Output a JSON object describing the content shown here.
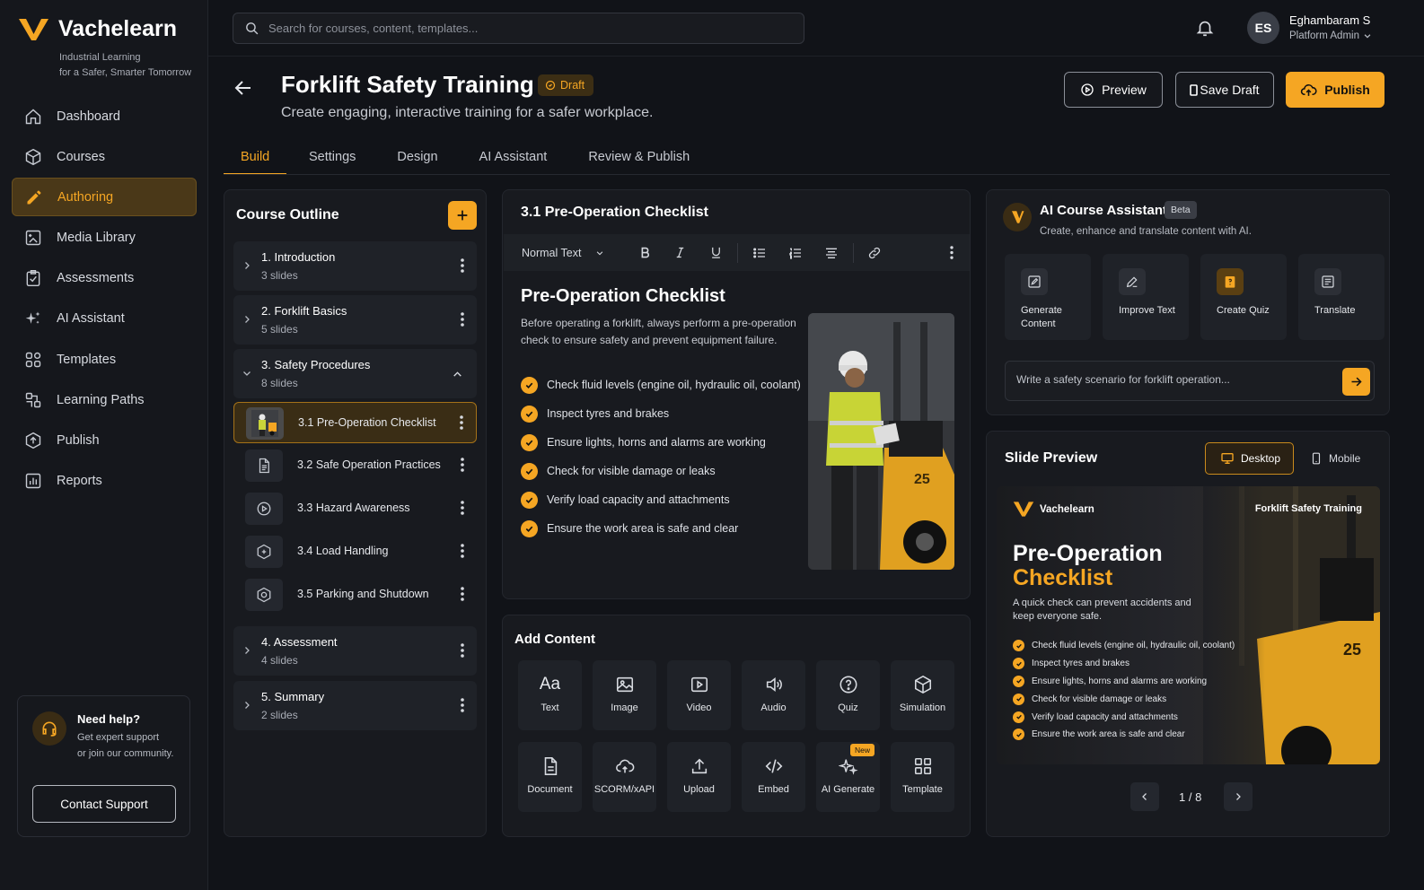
{
  "brand": {
    "name": "Vachelearn",
    "tagline_1": "Industrial Learning",
    "tagline_2": "for a Safer, Smarter Tomorrow"
  },
  "nav": [
    {
      "label": "Dashboard",
      "icon": "home-icon"
    },
    {
      "label": "Courses",
      "icon": "cube-icon"
    },
    {
      "label": "Authoring",
      "icon": "pencil-icon",
      "active": true
    },
    {
      "label": "Media Library",
      "icon": "media-icon"
    },
    {
      "label": "Assessments",
      "icon": "clipboard-check-icon"
    },
    {
      "label": "AI Assistant",
      "icon": "sparkle-icon"
    },
    {
      "label": "Templates",
      "icon": "grid-icon"
    },
    {
      "label": "Learning Paths",
      "icon": "path-icon"
    },
    {
      "label": "Publish",
      "icon": "upload-icon"
    },
    {
      "label": "Reports",
      "icon": "chart-icon"
    }
  ],
  "help": {
    "title": "Need help?",
    "line_1": "Get expert support",
    "line_2": "or join our community.",
    "button": "Contact Support"
  },
  "search": {
    "placeholder": "Search for courses, content, templates..."
  },
  "user": {
    "initials": "ES",
    "name": "Eghambaram S",
    "role": "Platform Admin"
  },
  "header": {
    "title": "Forklift Safety Training",
    "status": "Draft",
    "subtitle": "Create engaging, interactive training for a safer workplace.",
    "preview": "Preview",
    "save_draft": "Save Draft",
    "publish": "Publish"
  },
  "tabs": [
    "Build",
    "Settings",
    "Design",
    "AI Assistant",
    "Review & Publish"
  ],
  "outline": {
    "title": "Course Outline",
    "sections": [
      {
        "title": "1. Introduction",
        "count": "3 slides"
      },
      {
        "title": "2. Forklift Basics",
        "count": "5 slides"
      },
      {
        "title": "3. Safety Procedures",
        "count": "8 slides"
      },
      {
        "title": "4. Assessment",
        "count": "4 slides"
      },
      {
        "title": "5. Summary",
        "count": "2 slides"
      }
    ],
    "slides": [
      {
        "label": "3.1 Pre-Operation Checklist",
        "icon": "forklift-thumb-icon",
        "active": true
      },
      {
        "label": "3.2 Safe Operation Practices",
        "icon": "document-icon"
      },
      {
        "label": "3.3 Hazard Awareness",
        "icon": "play-circle-icon"
      },
      {
        "label": "3.4 Load Handling",
        "icon": "box-plus-icon"
      },
      {
        "label": "3.5 Parking and Shutdown",
        "icon": "parking-icon"
      }
    ]
  },
  "editor": {
    "title": "3.1 Pre-Operation Checklist",
    "format": "Normal Text",
    "heading": "Pre-Operation Checklist",
    "paragraph": "Before operating a forklift, always perform a pre-operation check to ensure safety and prevent equipment failure.",
    "checks": [
      "Check fluid levels (engine oil, hydraulic oil, coolant)",
      "Inspect tyres and brakes",
      "Ensure lights, horns and alarms are working",
      "Check for visible damage or leaks",
      "Verify load capacity and attachments",
      "Ensure the work area is safe and clear"
    ]
  },
  "add_content": {
    "title": "Add Content",
    "items": [
      {
        "label": "Text",
        "glyph": "Aa"
      },
      {
        "label": "Image"
      },
      {
        "label": "Video"
      },
      {
        "label": "Audio"
      },
      {
        "label": "Quiz"
      },
      {
        "label": "Simulation"
      },
      {
        "label": "Document"
      },
      {
        "label": "SCORM/xAPI"
      },
      {
        "label": "Upload"
      },
      {
        "label": "Embed"
      },
      {
        "label": "AI Generate",
        "badge": "New"
      },
      {
        "label": "Template"
      }
    ]
  },
  "ai": {
    "title": "AI Course Assistant",
    "badge": "Beta",
    "subtitle": "Create, enhance and translate content with AI.",
    "actions": [
      {
        "line_1": "Generate",
        "line_2": "Content"
      },
      {
        "line_1": "Improve Text",
        "line_2": ""
      },
      {
        "line_1": "Create Quiz",
        "line_2": ""
      },
      {
        "line_1": "Translate",
        "line_2": ""
      }
    ],
    "prompt_placeholder": "Write a safety scenario for forklift operation..."
  },
  "preview": {
    "title": "Slide Preview",
    "desktop": "Desktop",
    "mobile": "Mobile",
    "brand": "Vachelearn",
    "course": "Forklift Safety Training",
    "heading_1": "Pre-Operation",
    "heading_2": "Checklist",
    "sub": "A quick check can prevent accidents and keep everyone safe.",
    "checks": [
      "Check fluid levels (engine oil, hydraulic oil, coolant)",
      "Inspect tyres and brakes",
      "Ensure lights, horns and alarms are working",
      "Check for visible damage or leaks",
      "Verify load capacity and attachments",
      "Ensure the work area is safe and clear"
    ],
    "page": "1 / 8"
  },
  "colors": {
    "accent": "#f5a623",
    "background": "#111318",
    "panel": "#181a1f"
  }
}
